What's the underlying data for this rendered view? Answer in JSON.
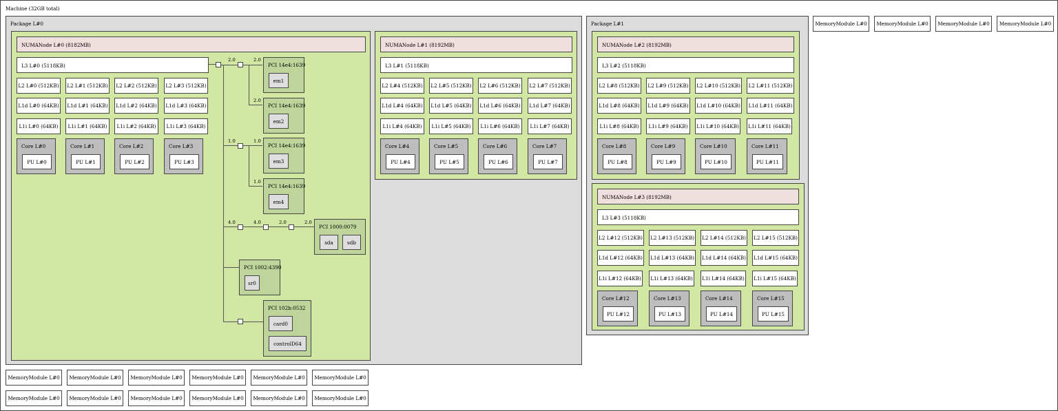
{
  "machine": {
    "label": "Machine (32GB total)"
  },
  "packages": [
    {
      "label": "Package L#0",
      "numas": [
        {
          "label": "NUMANode L#0 (8182MB)",
          "l3": "L3 L#0 (5118KB)",
          "l2": [
            "L2 L#0 (512KB)",
            "L2 L#1 (512KB)",
            "L2 L#2 (512KB)",
            "L2 L#3 (512KB)"
          ],
          "l1d": [
            "L1d L#0 (64KB)",
            "L1d L#1 (64KB)",
            "L1d L#2 (64KB)",
            "L1d L#3 (64KB)"
          ],
          "l1i": [
            "L1i L#0 (64KB)",
            "L1i L#1 (64KB)",
            "L1i L#2 (64KB)",
            "L1i L#3 (64KB)"
          ],
          "cores": [
            "Core L#0",
            "Core L#1",
            "Core L#2",
            "Core L#3"
          ],
          "pus": [
            "PU L#0",
            "PU L#1",
            "PU L#2",
            "PU L#3"
          ]
        },
        {
          "label": "NUMANode L#1 (8192MB)",
          "l3": "L3 L#1 (5118KB)",
          "l2": [
            "L2 L#4 (512KB)",
            "L2 L#5 (512KB)",
            "L2 L#6 (512KB)",
            "L2 L#7 (512KB)"
          ],
          "l1d": [
            "L1d L#4 (64KB)",
            "L1d L#5 (64KB)",
            "L1d L#6 (64KB)",
            "L1d L#7 (64KB)"
          ],
          "l1i": [
            "L1i L#4 (64KB)",
            "L1i L#5 (64KB)",
            "L1i L#6 (64KB)",
            "L1i L#7 (64KB)"
          ],
          "cores": [
            "Core L#4",
            "Core L#5",
            "Core L#6",
            "Core L#7"
          ],
          "pus": [
            "PU L#4",
            "PU L#5",
            "PU L#6",
            "PU L#7"
          ]
        }
      ]
    },
    {
      "label": "Package L#1",
      "numas": [
        {
          "label": "NUMANode L#2 (8192MB)",
          "l3": "L3 L#2 (5118KB)",
          "l2": [
            "L2 L#8 (512KB)",
            "L2 L#9 (512KB)",
            "L2 L#10 (512KB)",
            "L2 L#11 (512KB)"
          ],
          "l1d": [
            "L1d L#8 (64KB)",
            "L1d L#9 (64KB)",
            "L1d L#10 (64KB)",
            "L1d L#11 (64KB)"
          ],
          "l1i": [
            "L1i L#8 (64KB)",
            "L1i L#9 (64KB)",
            "L1i L#10 (64KB)",
            "L1i L#11 (64KB)"
          ],
          "cores": [
            "Core L#8",
            "Core L#9",
            "Core L#10",
            "Core L#11"
          ],
          "pus": [
            "PU L#8",
            "PU L#9",
            "PU L#10",
            "PU L#11"
          ]
        },
        {
          "label": "NUMANode L#3 (8192MB)",
          "l3": "L3 L#3 (5118KB)",
          "l2": [
            "L2 L#12 (512KB)",
            "L2 L#13 (512KB)",
            "L2 L#14 (512KB)",
            "L2 L#15 (512KB)"
          ],
          "l1d": [
            "L1d L#12 (64KB)",
            "L1d L#13 (64KB)",
            "L1d L#14 (64KB)",
            "L1d L#15 (64KB)"
          ],
          "l1i": [
            "L1i L#12 (64KB)",
            "L1i L#13 (64KB)",
            "L1i L#14 (64KB)",
            "L1i L#15 (64KB)"
          ],
          "cores": [
            "Core L#12",
            "Core L#13",
            "Core L#14",
            "Core L#15"
          ],
          "pus": [
            "PU L#12",
            "PU L#13",
            "PU L#14",
            "PU L#15"
          ]
        }
      ]
    }
  ],
  "pci": {
    "bw_2_0": "2.0",
    "bw_1_0": "1.0",
    "bw_4_0": "4.0",
    "devices": [
      {
        "label": "PCI 14e4:1639",
        "os": [
          "em1"
        ]
      },
      {
        "label": "PCI 14e4:1639",
        "os": [
          "em2"
        ]
      },
      {
        "label": "PCI 14e4:1639",
        "os": [
          "em3"
        ]
      },
      {
        "label": "PCI 14e4:1639",
        "os": [
          "em4"
        ]
      },
      {
        "label": "PCI 1000:0079",
        "os": [
          "sda",
          "sdb"
        ]
      },
      {
        "label": "PCI 1002:4390",
        "os": [
          "sr0"
        ]
      },
      {
        "label": "PCI 102b:0532",
        "os": [
          "card0",
          "controlD64"
        ]
      }
    ]
  },
  "memory_modules": {
    "label": "MemoryModule L#0"
  }
}
